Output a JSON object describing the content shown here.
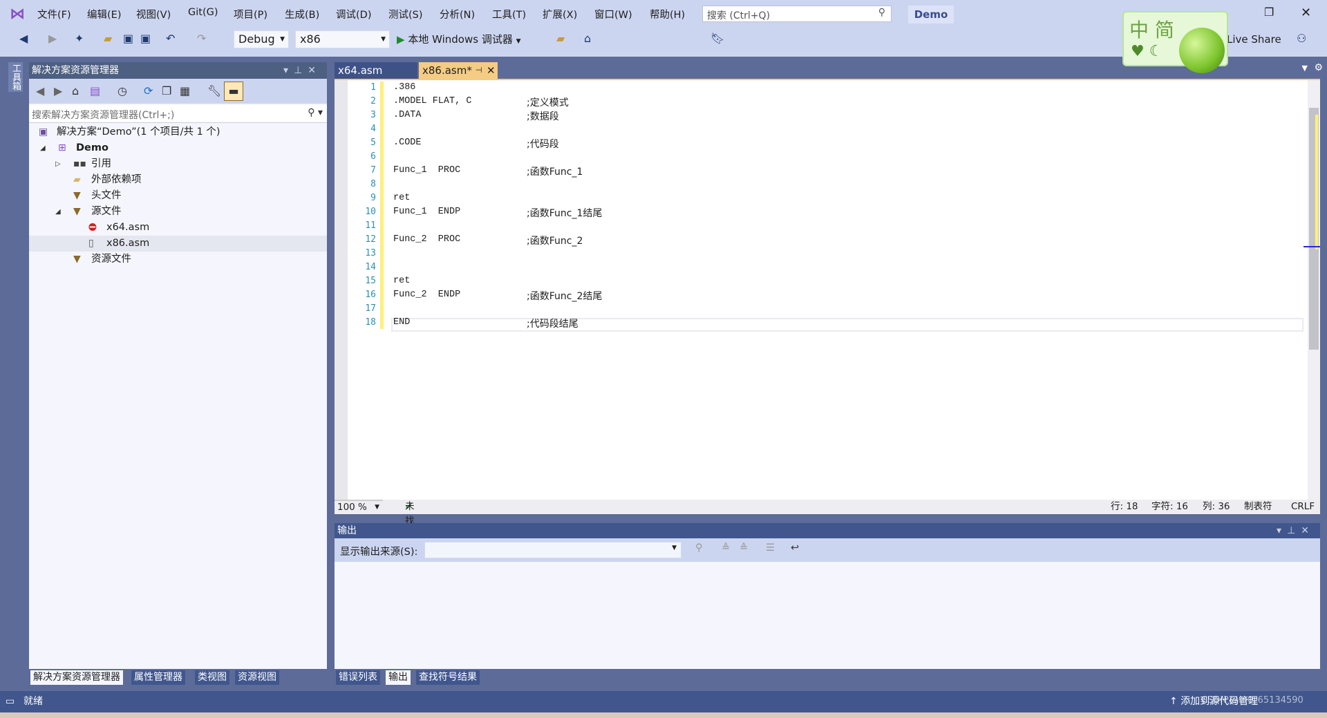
{
  "menu": [
    "文件(F)",
    "编辑(E)",
    "视图(V)",
    "Git(G)",
    "项目(P)",
    "生成(B)",
    "调试(D)",
    "测试(S)",
    "分析(N)",
    "工具(T)",
    "扩展(X)",
    "窗口(W)",
    "帮助(H)"
  ],
  "search_placeholder": "搜索 (Ctrl+Q)",
  "solution_name": "Demo",
  "toolbar": {
    "config": "Debug",
    "platform": "x86",
    "run_label": "本地 Windows 调试器",
    "live_share": "Live Share"
  },
  "ime": {
    "text": "中 简"
  },
  "toolbox_label": "工具箱",
  "solution_explorer": {
    "title": "解决方案资源管理器",
    "search_placeholder": "搜索解决方案资源管理器(Ctrl+;)",
    "tree": [
      {
        "label": "解决方案“Demo”(1 个项目/共 1 个)",
        "level": 0,
        "icon": "solution-icon",
        "expander": ""
      },
      {
        "label": "Demo",
        "level": 0,
        "icon": "project-icon",
        "expander": "◢",
        "bold": true
      },
      {
        "label": "引用",
        "level": 1,
        "icon": "references-icon",
        "expander": "▷"
      },
      {
        "label": "外部依赖项",
        "level": 1,
        "icon": "folder-icon",
        "expander": ""
      },
      {
        "label": "头文件",
        "level": 1,
        "icon": "filter-folder-icon",
        "expander": ""
      },
      {
        "label": "源文件",
        "level": 1,
        "icon": "filter-folder-icon",
        "expander": "◢"
      },
      {
        "label": "x64.asm",
        "level": 2,
        "icon": "file-excluded-icon",
        "expander": ""
      },
      {
        "label": "x86.asm",
        "level": 2,
        "icon": "file-icon",
        "expander": "",
        "selected": true
      },
      {
        "label": "资源文件",
        "level": 1,
        "icon": "filter-folder-icon",
        "expander": ""
      }
    ]
  },
  "editor": {
    "tabs": [
      {
        "label": "x64.asm",
        "active": false
      },
      {
        "label": "x86.asm*",
        "active": true
      }
    ],
    "lines": [
      {
        "n": "1",
        "code": ".386",
        "comment": ""
      },
      {
        "n": "2",
        "code": ".MODEL FLAT, C",
        "comment": ";定义模式"
      },
      {
        "n": "3",
        "code": ".DATA",
        "comment": ";数据段"
      },
      {
        "n": "4",
        "code": "",
        "comment": ""
      },
      {
        "n": "5",
        "code": ".CODE",
        "comment": ";代码段"
      },
      {
        "n": "6",
        "code": "",
        "comment": ""
      },
      {
        "n": "7",
        "code": "Func_1  PROC",
        "comment": ";函数Func_1"
      },
      {
        "n": "8",
        "code": "",
        "comment": ""
      },
      {
        "n": "9",
        "code": "ret",
        "comment": ""
      },
      {
        "n": "10",
        "code": "Func_1  ENDP",
        "comment": ";函数Func_1结尾"
      },
      {
        "n": "11",
        "code": "",
        "comment": ""
      },
      {
        "n": "12",
        "code": "Func_2  PROC",
        "comment": ";函数Func_2"
      },
      {
        "n": "13",
        "code": "",
        "comment": ""
      },
      {
        "n": "14",
        "code": "",
        "comment": ""
      },
      {
        "n": "15",
        "code": "ret",
        "comment": ""
      },
      {
        "n": "16",
        "code": "Func_2  ENDP",
        "comment": ";函数Func_2结尾"
      },
      {
        "n": "17",
        "code": "",
        "comment": ""
      },
      {
        "n": "18",
        "code": "END",
        "comment": ";代码段结尾"
      }
    ],
    "status": {
      "zoom": "100 %",
      "issues": "未找到相关问题",
      "line": "行: 18",
      "char": "字符: 16",
      "col": "列: 36",
      "tabs": "制表符",
      "eol": "CRLF"
    }
  },
  "output": {
    "title": "输出",
    "source_label": "显示输出来源(S):",
    "source_value": ""
  },
  "bottom_tabs_left": [
    "解决方案资源管理器",
    "属性管理器",
    "类视图",
    "资源视图"
  ],
  "bottom_tabs_right": [
    "错误列表",
    "输出",
    "查找符号结果"
  ],
  "status": {
    "ready": "就绪",
    "source_control": "添加到源代码管理",
    "watermark": "CSDN @m0_65134590"
  },
  "colors": {
    "frame": "#5d6b99",
    "chrome": "#ccd5f0",
    "active_tab": "#f5cc84",
    "status_bar": "#40568d"
  }
}
